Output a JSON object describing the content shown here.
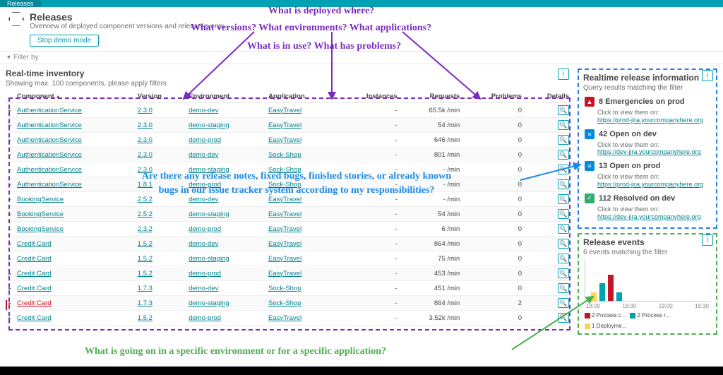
{
  "topbar": {
    "tab": "Releases"
  },
  "header": {
    "title": "Releases",
    "subtitle": "Overview of deployed component versions and release events",
    "demo_btn": "Stop demo mode"
  },
  "filter": {
    "label": "Filter by"
  },
  "inventory": {
    "title": "Real-time inventory",
    "subtitle": "Showing max. 100 components, please apply filters",
    "columns": {
      "component": "Component",
      "version": "Version",
      "environment": "Environment",
      "application": "Application",
      "instances": "Instances",
      "requests": "Requests",
      "problems": "Problems",
      "details": "Details"
    },
    "rows": [
      {
        "component": "AuthenticationService",
        "version": "2.3.0",
        "environment": "demo-dev",
        "application": "EasyTravel",
        "instances": "-",
        "requests": "65.5k /min",
        "problems": "0",
        "err": false
      },
      {
        "component": "AuthenticationService",
        "version": "2.3.0",
        "environment": "demo-staging",
        "application": "EasyTravel",
        "instances": "-",
        "requests": "54 /min",
        "problems": "0",
        "err": false
      },
      {
        "component": "AuthenticationService",
        "version": "2.3.0",
        "environment": "demo-prod",
        "application": "EasyTravel",
        "instances": "-",
        "requests": "646 /min",
        "problems": "0",
        "err": false
      },
      {
        "component": "AuthenticationService",
        "version": "2.3.0",
        "environment": "demo-dev",
        "application": "Sock-Shop",
        "instances": "-",
        "requests": "801 /min",
        "problems": "0",
        "err": false
      },
      {
        "component": "AuthenticationService",
        "version": "2.3.0",
        "environment": "demo-staging",
        "application": "Sock-Shop",
        "instances": "-",
        "requests": "- /min",
        "problems": "0",
        "err": false
      },
      {
        "component": "AuthenticationService",
        "version": "1.8.1",
        "environment": "demo-prod",
        "application": "Sock-Shop",
        "instances": "-",
        "requests": "- /min",
        "problems": "0",
        "err": false
      },
      {
        "component": "BookingService",
        "version": "2.5.2",
        "environment": "demo-dev",
        "application": "EasyTravel",
        "instances": "-",
        "requests": "- /min",
        "problems": "0",
        "err": false
      },
      {
        "component": "BookingService",
        "version": "2.5.2",
        "environment": "demo-staging",
        "application": "EasyTravel",
        "instances": "-",
        "requests": "54 /min",
        "problems": "0",
        "err": false
      },
      {
        "component": "BookingService",
        "version": "2.3.2",
        "environment": "demo-prod",
        "application": "EasyTravel",
        "instances": "-",
        "requests": "6 /min",
        "problems": "0",
        "err": false
      },
      {
        "component": "Credit Card",
        "version": "1.5.2",
        "environment": "demo-dev",
        "application": "EasyTravel",
        "instances": "-",
        "requests": "864 /min",
        "problems": "0",
        "err": false
      },
      {
        "component": "Credit Card",
        "version": "1.5.2",
        "environment": "demo-staging",
        "application": "EasyTravel",
        "instances": "-",
        "requests": "75 /min",
        "problems": "0",
        "err": false
      },
      {
        "component": "Credit Card",
        "version": "1.5.2",
        "environment": "demo-prod",
        "application": "EasyTravel",
        "instances": "-",
        "requests": "453 /min",
        "problems": "0",
        "err": false
      },
      {
        "component": "Credit Card",
        "version": "1.7.3",
        "environment": "demo-dev",
        "application": "Sock-Shop",
        "instances": "-",
        "requests": "451 /min",
        "problems": "0",
        "err": false
      },
      {
        "component": "Credit Card",
        "version": "1.7.3",
        "environment": "demo-staging",
        "application": "Sock-Shop",
        "instances": "-",
        "requests": "864 /min",
        "problems": "2",
        "err": true
      },
      {
        "component": "Credit Card",
        "version": "1.5.2",
        "environment": "demo-prod",
        "application": "EasyTravel",
        "instances": "-",
        "requests": "3.52k /min",
        "problems": "0",
        "err": false
      }
    ]
  },
  "realtime": {
    "title": "Realtime release information",
    "subtitle": "Query results matching the filter",
    "items": [
      {
        "badge": "▲",
        "color": "b-red",
        "title": "8 Emergencies on prod",
        "sub": "Click to view them on:",
        "link": "https://prod-jira.yourcompanyhere.org"
      },
      {
        "badge": "≡",
        "color": "b-blue",
        "title": "42 Open on dev",
        "sub": "Click to view them on:",
        "link": "https://dev-jira.yourcompanyhere.org"
      },
      {
        "badge": "≡",
        "color": "b-blue",
        "title": "13 Open on prod",
        "sub": "Click to view them on:",
        "link": "https://prod-jira.yourcompanyhere.org"
      },
      {
        "badge": "✓",
        "color": "b-green",
        "title": "112 Resolved on dev",
        "sub": "Click to view them on:",
        "link": "https://dev-jira.yourcompanyhere.org"
      }
    ]
  },
  "events": {
    "title": "Release events",
    "subtitle": "6 events matching the filter",
    "xlabels": [
      "18:00",
      "18:30",
      "19:00",
      "19:30"
    ],
    "legend": [
      {
        "color": "#c41425",
        "label": "2 Process c..."
      },
      {
        "color": "#00a1b2",
        "label": "2 Process r..."
      },
      {
        "color": "#ffd54f",
        "label": "1 Deployme..."
      }
    ]
  },
  "chart_data": {
    "type": "bar",
    "categories": [
      "18:00",
      "18:15",
      "18:30",
      "18:45",
      "19:00",
      "19:15",
      "19:30"
    ],
    "series": [
      {
        "name": "Process crashed",
        "color": "#c41425",
        "values": [
          0,
          0,
          0,
          3,
          0,
          0,
          0
        ]
      },
      {
        "name": "Process restart",
        "color": "#00a1b2",
        "values": [
          0,
          0,
          2,
          0,
          1,
          0,
          0
        ]
      },
      {
        "name": "Deployment",
        "color": "#ffd54f",
        "values": [
          0,
          1,
          0,
          0,
          0,
          0,
          0
        ]
      }
    ],
    "ylim": [
      0,
      4
    ],
    "title": "Release events"
  },
  "annotations": {
    "q1": "What is deployed where?",
    "q2": "What versions? What environments? What applications?",
    "q3": "What is in use? What has problems?",
    "q4a": "Are there any release notes, fixed bugs, finished stories, or already known",
    "q4b": "bugs in our issue tracker system according to my responsibilities?",
    "q5": "What is going on in a specific environment or for a specific application?"
  }
}
